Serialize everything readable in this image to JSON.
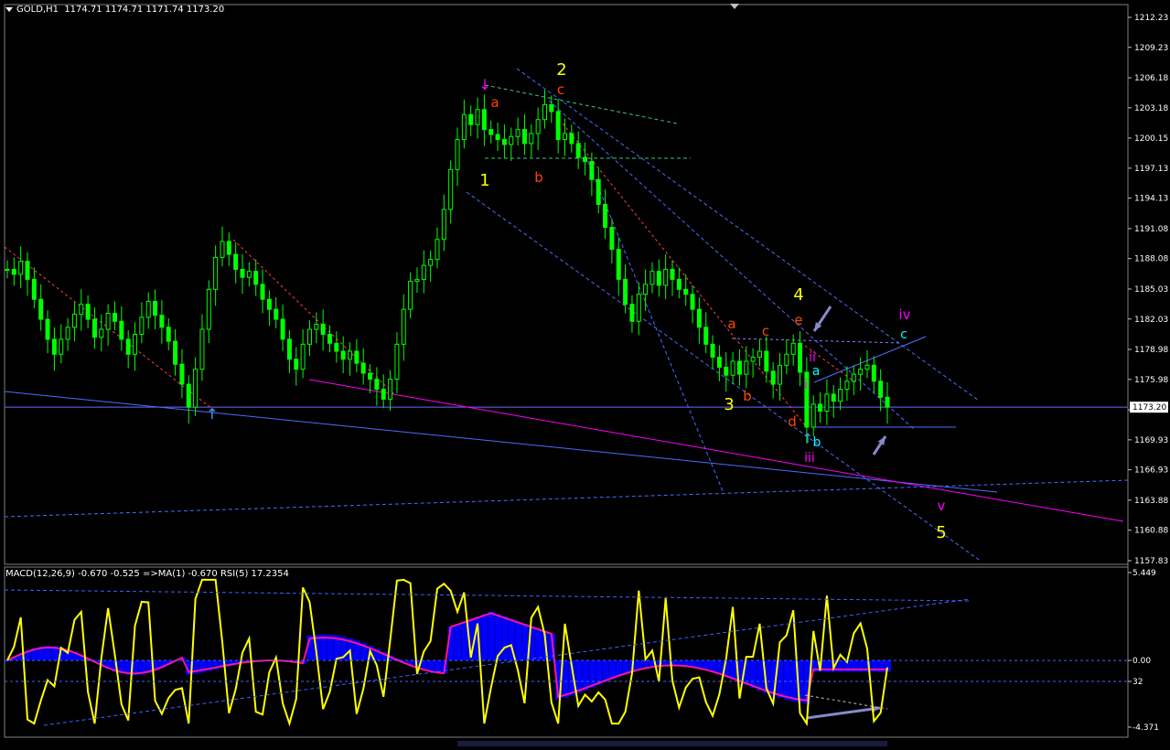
{
  "window": {
    "symbol_label": "GOLD,H1",
    "ohlc": "1174.71 1174.71 1171.74 1173.20"
  },
  "price_axis": {
    "ticks": [
      "1212.23",
      "1209.23",
      "1206.18",
      "1203.18",
      "1200.15",
      "1197.13",
      "1194.13",
      "1191.08",
      "1188.08",
      "1185.03",
      "1182.03",
      "1178.98",
      "1175.98",
      "1172.93",
      "1169.93",
      "1166.93",
      "1163.88",
      "1160.88",
      "1157.83"
    ],
    "current_price": "1173.20"
  },
  "indicator": {
    "header": "MACD(12,26,9) -0.670 -0.525  =>MA(1) -0.670  RSI(5) 17.2354",
    "ticks": [
      "5.449",
      "0.00",
      "32",
      "-4.371"
    ]
  },
  "wave_labels": {
    "primary": [
      "1",
      "2",
      "3",
      "4",
      "5"
    ],
    "sub_abc_top": [
      "a",
      "b",
      "c"
    ],
    "sub_4": [
      "a",
      "b",
      "c",
      "d",
      "e"
    ],
    "minor": [
      "i",
      "ii",
      "iii",
      "iv",
      "v"
    ],
    "final": [
      "a",
      "b",
      "c"
    ]
  },
  "colors": {
    "background": "#000000",
    "candles": "#00ff00",
    "axis": "#ffffff",
    "primary_wave": "#ffff00",
    "sub_wave": "#ff4500",
    "minor_wave": "#ff00ff",
    "final_wave": "#00ffff",
    "trendline_blue": "#4060ff",
    "trendline_magenta": "#ff00ff",
    "macd_hist": "#0000ff",
    "macd_signal": "#ff1493",
    "rsi_line": "#ffff00",
    "arrow": "#8888cc"
  },
  "chart_data": {
    "type": "candlestick",
    "symbol": "GOLD",
    "timeframe": "H1",
    "ylim": [
      1157.83,
      1212.23
    ],
    "close_series": [
      1187,
      1186.5,
      1187.8,
      1186,
      1184,
      1182,
      1180,
      1178.5,
      1180,
      1181.2,
      1182.5,
      1183.5,
      1182,
      1180.2,
      1181,
      1182.6,
      1181.8,
      1180,
      1178.5,
      1180.5,
      1182.2,
      1183.8,
      1182.4,
      1181.2,
      1179.8,
      1177.5,
      1175.5,
      1173.2,
      1177,
      1181,
      1185,
      1188.2,
      1189.8,
      1188.5,
      1187,
      1186.2,
      1186.8,
      1185.5,
      1184,
      1183,
      1182,
      1180,
      1178,
      1177,
      1179.5,
      1181,
      1181.5,
      1180.5,
      1179.6,
      1178.8,
      1178,
      1178.8,
      1177.6,
      1176.6,
      1176,
      1175,
      1174,
      1176,
      1179.5,
      1183,
      1185.8,
      1186,
      1187.4,
      1188,
      1190,
      1193,
      1197,
      1200,
      1202.5,
      1201.5,
      1203,
      1201,
      1200.5,
      1200,
      1199.5,
      1200.3,
      1201,
      1199.6,
      1200.6,
      1202,
      1203.5,
      1202.8,
      1200,
      1200.6,
      1199.6,
      1198.2,
      1197.8,
      1196,
      1193.5,
      1191.2,
      1189,
      1186,
      1183.5,
      1181.8,
      1184.5,
      1185.5,
      1186.8,
      1185.4,
      1187,
      1186,
      1185,
      1184.5,
      1183,
      1181.2,
      1179.5,
      1178.2,
      1177.2,
      1176.4,
      1177.8,
      1176.5,
      1177.8,
      1178.2,
      1178.8,
      1176.8,
      1175.5,
      1177.4,
      1178.5,
      1179.6,
      1176.7,
      1171.2,
      1173.5,
      1172.8,
      1174.5,
      1173.8,
      1175,
      1175.8,
      1176.5,
      1177,
      1177.4,
      1175.8,
      1174.2,
      1173.2
    ],
    "wave_annotations": [
      {
        "label": "1",
        "price": 1197.0
      },
      {
        "label": "2",
        "price": 1206.5
      },
      {
        "label": "3",
        "price": 1173.5
      },
      {
        "label": "4",
        "price": 1184.5
      },
      {
        "label": "5",
        "price": 1160.8
      },
      {
        "label": "iv",
        "price": 1182.5
      },
      {
        "label": "v",
        "price": 1164.0
      }
    ],
    "indicators": {
      "macd": {
        "params": "12,26,9",
        "main": -0.67,
        "signal": -0.525
      },
      "ma": {
        "period": 1,
        "value": -0.67
      },
      "rsi": {
        "period": 5,
        "value": 17.2354
      },
      "ylim": [
        -4.371,
        5.449
      ]
    }
  }
}
